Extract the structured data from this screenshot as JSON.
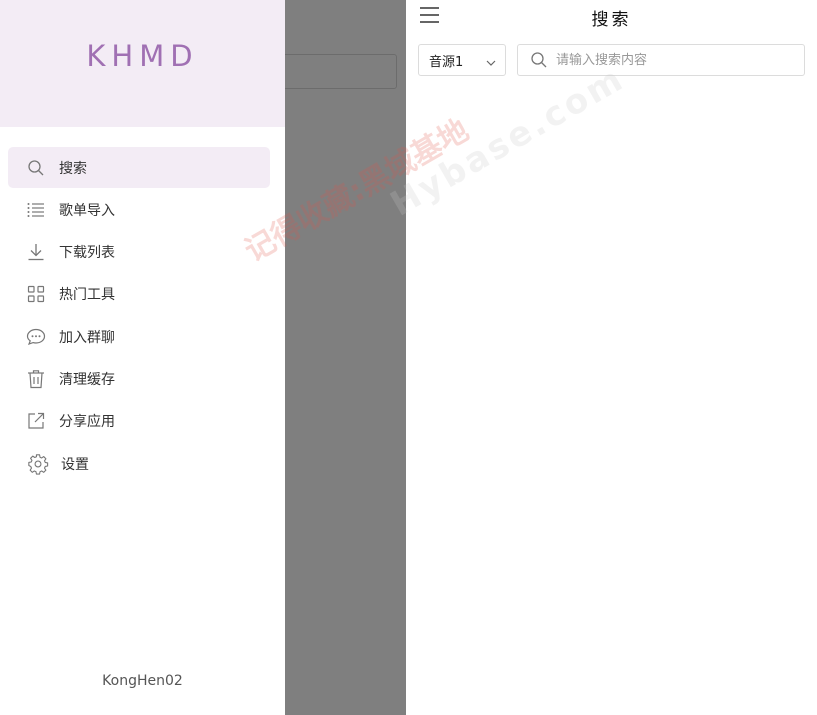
{
  "drawer": {
    "brand": "KHMD",
    "menu": [
      {
        "label": "搜索",
        "icon": "search-icon",
        "active": true
      },
      {
        "label": "歌单导入",
        "icon": "list-icon",
        "active": false
      },
      {
        "label": "下载列表",
        "icon": "download-icon",
        "active": false
      },
      {
        "label": "热门工具",
        "icon": "grid-icon",
        "active": false
      },
      {
        "label": "加入群聊",
        "icon": "chat-icon",
        "active": false
      },
      {
        "label": "清理缓存",
        "icon": "trash-icon",
        "active": false
      },
      {
        "label": "分享应用",
        "icon": "share-icon",
        "active": false
      },
      {
        "label": "设置",
        "icon": "gear-icon",
        "active": false
      }
    ],
    "footer": "KongHen02"
  },
  "search_page": {
    "title": "搜索",
    "source_select": {
      "value": "音源1"
    },
    "search": {
      "placeholder": "请输入搜索内容",
      "value": ""
    }
  },
  "watermark": {
    "line1": "记得收藏:黑域基地",
    "line2": "Hybase.com"
  },
  "colors": {
    "accent": "#a070b3",
    "active_bg": "#f3ecf5",
    "scrim": "#808080"
  }
}
